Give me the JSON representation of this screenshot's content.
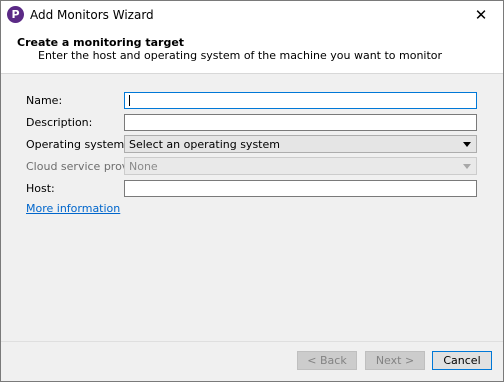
{
  "window": {
    "title": "Add Monitors Wizard",
    "app_icon_letter": "P",
    "close_symbol": "✕"
  },
  "header": {
    "title": "Create a monitoring target",
    "subtitle": "Enter the host and operating system of the machine you want to monitor"
  },
  "form": {
    "name": {
      "label": "Name:",
      "value": ""
    },
    "description": {
      "label": "Description:",
      "value": ""
    },
    "operating_system": {
      "label": "Operating system:",
      "value": "Select an operating system"
    },
    "cloud_provider": {
      "label": "Cloud service provider:",
      "value": "None"
    },
    "host": {
      "label": "Host:",
      "value": ""
    }
  },
  "more_info_link": "More information",
  "buttons": {
    "back": "< Back",
    "next": "Next >",
    "cancel": "Cancel"
  }
}
